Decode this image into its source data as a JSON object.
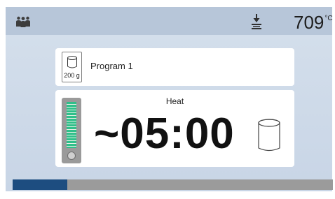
{
  "header": {
    "users_icon": "users-icon",
    "vacuum_icon": "vacuum-icon",
    "temperature_value": "709",
    "temperature_unit": "°C"
  },
  "program": {
    "weight_icon": "cylinder-icon",
    "weight_label": "200 g",
    "name": "Program 1"
  },
  "heat_panel": {
    "title": "Heat",
    "remaining_time": "~05:00",
    "level_fraction": 1.0,
    "gauge_icon": "gauge-icon",
    "tray_icon": "firing-tray-icon"
  },
  "progress": {
    "fraction": 0.17
  },
  "colors": {
    "header_bg": "#b7c6d9",
    "main_bg": "#cbd8e8",
    "gauge_green": "#2fbf8a",
    "progress_fill": "#1d4d80",
    "progress_track": "#9b9b9b"
  }
}
